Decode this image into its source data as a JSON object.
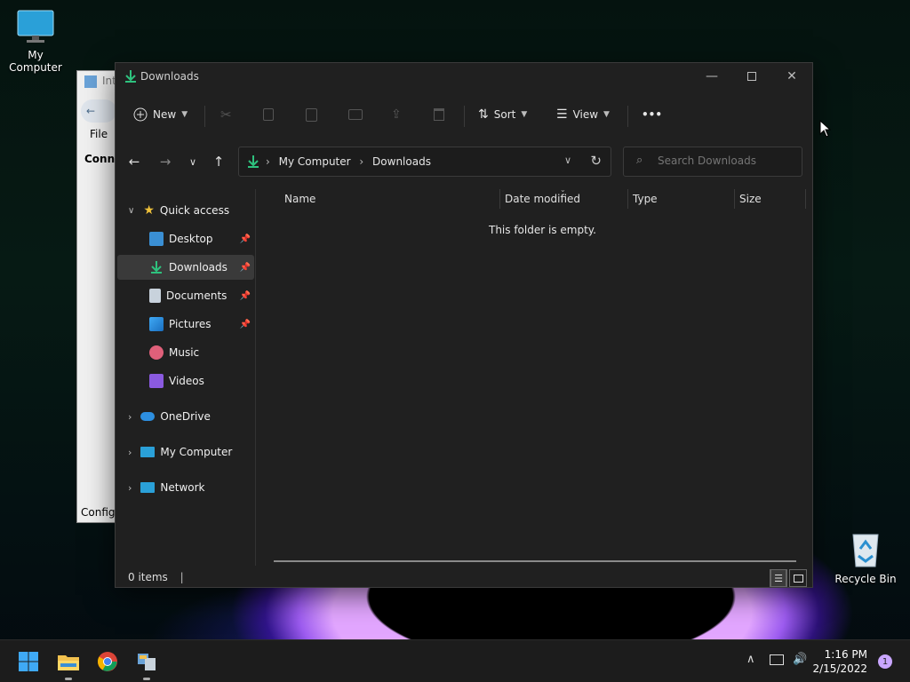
{
  "desktop": {
    "icons": [
      {
        "label": "My Computer"
      },
      {
        "label": "Recycle Bin"
      }
    ]
  },
  "background_window": {
    "title": "Int",
    "menu_file": "File",
    "section": "Conne",
    "footer": "Configu"
  },
  "window": {
    "title": "Downloads",
    "toolbar": {
      "new_label": "New",
      "sort_label": "Sort",
      "view_label": "View",
      "more_label": "•••"
    },
    "address": {
      "crumbs": [
        "My Computer",
        "Downloads"
      ]
    },
    "search": {
      "placeholder": "Search Downloads"
    },
    "nav": {
      "quick_access": "Quick access",
      "pinned": [
        {
          "label": "Desktop"
        },
        {
          "label": "Downloads"
        },
        {
          "label": "Documents"
        },
        {
          "label": "Pictures"
        }
      ],
      "unpinned": [
        {
          "label": "Music"
        },
        {
          "label": "Videos"
        }
      ],
      "roots": [
        {
          "label": "OneDrive"
        },
        {
          "label": "My Computer"
        },
        {
          "label": "Network"
        }
      ]
    },
    "columns": [
      "Name",
      "Date modified",
      "Type",
      "Size"
    ],
    "empty_message": "This folder is empty.",
    "status": {
      "item_count": "0 items"
    }
  },
  "taskbar": {
    "time": "1:16 PM",
    "date": "2/15/2022",
    "notification_count": "1"
  },
  "colors": {
    "window_bg": "#202020",
    "accent_green": "#2ec27e",
    "taskbar_bg": "#1c1c1c"
  }
}
